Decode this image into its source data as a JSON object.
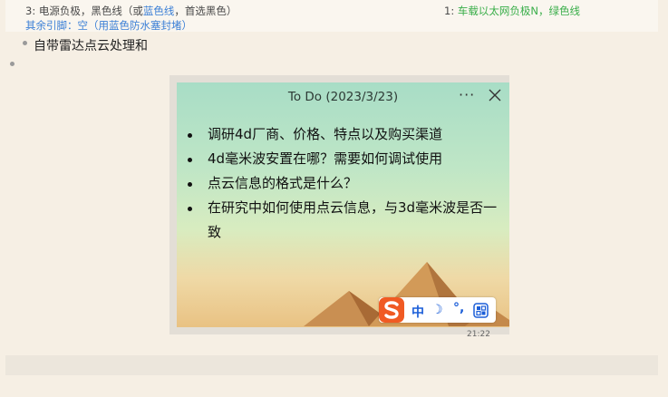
{
  "notes": {
    "row1_left_num": "3:",
    "row1_left_text_a": "电源负极，黑色线（或",
    "row1_left_blue": "蓝色线",
    "row1_left_text_b": "，首选黑色）",
    "row1_right_num": "1:",
    "row1_right_green": "车载以太网负极N，绿色线",
    "row2_blue": "其余引脚：空（用蓝色防水塞封堵）"
  },
  "outline": {
    "item1": "自带雷达点云处理和"
  },
  "sticky": {
    "title": "To Do (2023/3/23)",
    "more_label": "···",
    "items": [
      "调研4d厂商、价格、特点以及购买渠道",
      "4d毫米波安置在哪？需要如何调试使用",
      "点云信息的格式是什么？",
      "在研究中如何使用点云信息，与3d毫米波是否一致"
    ]
  },
  "ime": {
    "mode": "中",
    "moon": "☽",
    "punc": "°,"
  },
  "strip_text": "21:22",
  "colors": {
    "blue_text": "#3b7fd6",
    "green_text": "#3aae4a",
    "ime_orange": "#f05a23",
    "ime_blue": "#1b5ed8"
  }
}
